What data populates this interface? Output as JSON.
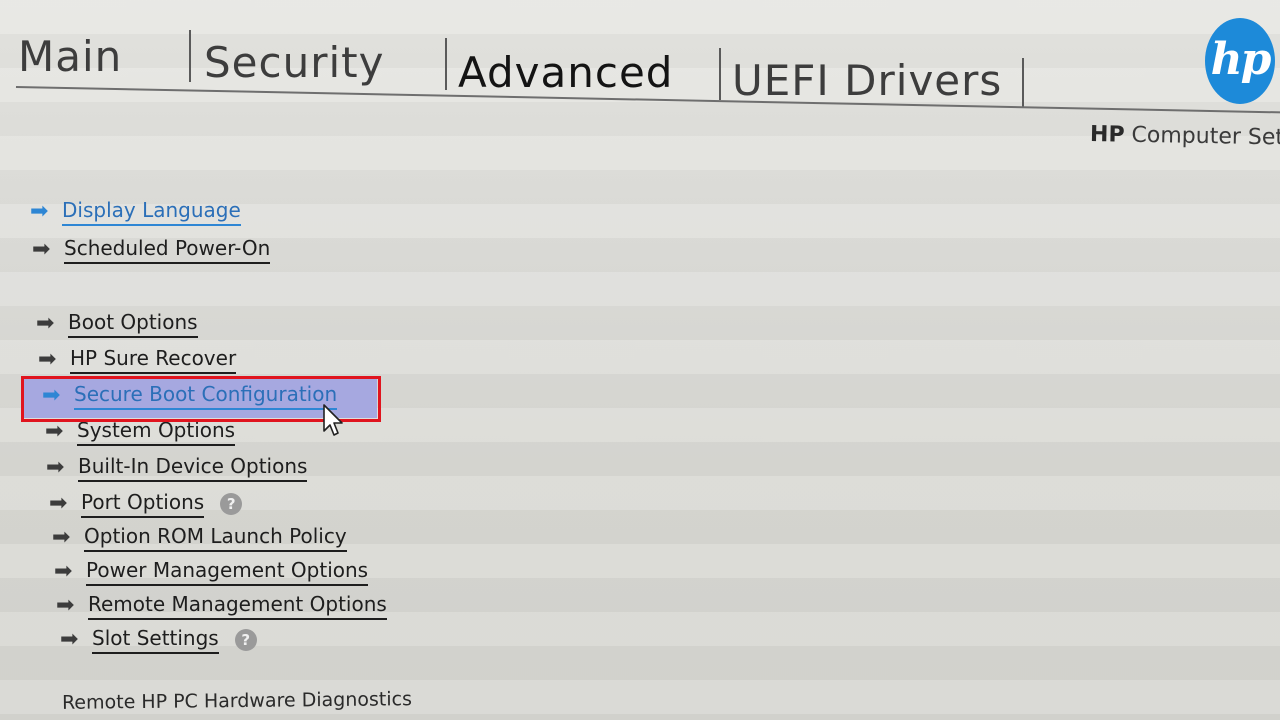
{
  "tabs": [
    {
      "label": "Main"
    },
    {
      "label": "Security"
    },
    {
      "label": "Advanced"
    },
    {
      "label": "UEFI Drivers"
    }
  ],
  "active_tab": "Advanced",
  "brand": {
    "logo_text": "hp",
    "setup_title_bold": "HP",
    "setup_title_rest": " Computer Setup",
    "logo_color": "#1d8ad9"
  },
  "menu": {
    "group1": [
      {
        "label": "Display Language",
        "accent": true,
        "icon": "arrow-right-icon"
      },
      {
        "label": "Scheduled Power-On",
        "icon": "arrow-right-icon"
      }
    ],
    "group2": [
      {
        "label": "Boot Options",
        "icon": "arrow-right-icon"
      },
      {
        "label": "HP Sure Recover",
        "icon": "arrow-right-icon"
      },
      {
        "label": "Secure Boot Configuration",
        "selected": true,
        "icon": "arrow-right-icon"
      },
      {
        "label": "System Options",
        "icon": "arrow-right-icon"
      },
      {
        "label": "Built-In Device Options",
        "icon": "arrow-right-icon"
      },
      {
        "label": "Port Options",
        "help": "?",
        "icon": "arrow-right-icon"
      },
      {
        "label": "Option ROM Launch Policy",
        "icon": "arrow-right-icon"
      },
      {
        "label": "Power Management Options",
        "icon": "arrow-right-icon"
      },
      {
        "label": "Remote Management Options",
        "icon": "arrow-right-icon"
      },
      {
        "label": "Slot Settings",
        "help": "?",
        "icon": "arrow-right-icon"
      }
    ],
    "footer_item": "Remote HP PC Hardware Diagnostics"
  },
  "colors": {
    "accent_blue": "#2e86d4",
    "selection_bg": "#a6a8e0",
    "highlight_border": "#e0141e"
  }
}
